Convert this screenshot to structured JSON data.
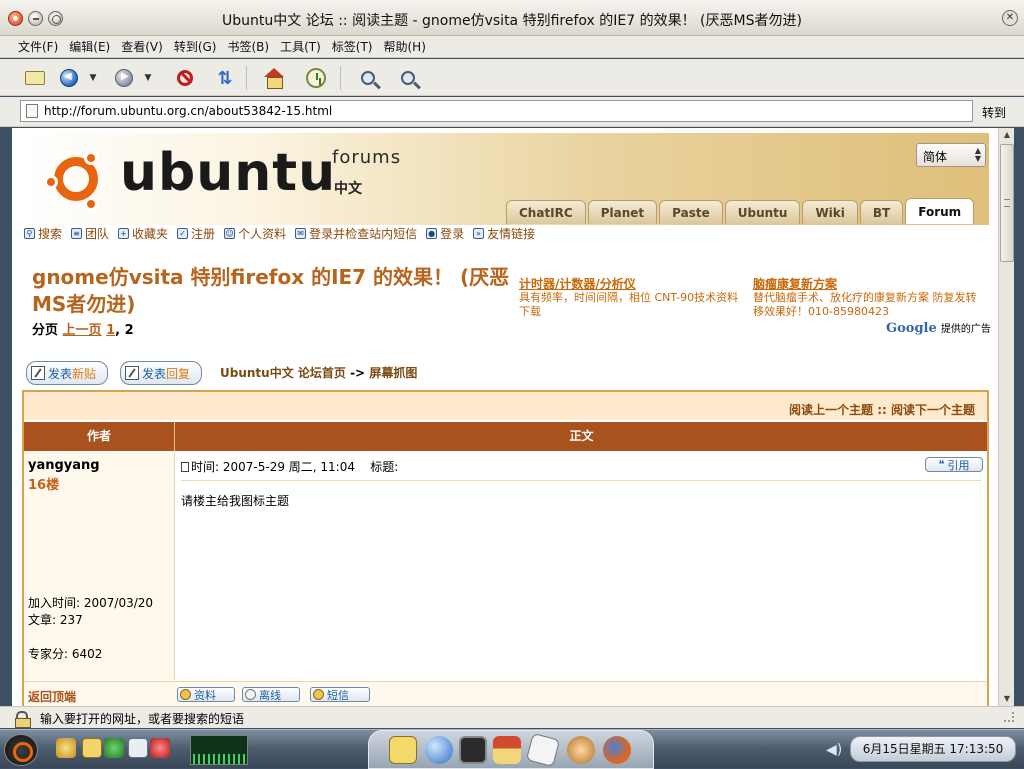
{
  "window": {
    "title": "Ubuntu中文 论坛 :: 阅读主题 - gnome仿vsita 特别firefox 的IE7 的效果！ (厌恶MS者勿进)"
  },
  "menubar": {
    "items": [
      "文件(F)",
      "编辑(E)",
      "查看(V)",
      "转到(G)",
      "书签(B)",
      "工具(T)",
      "标签(T)",
      "帮助(H)"
    ]
  },
  "toolbar": {
    "icons": [
      "new-window-icon",
      "back-icon",
      "forward-icon",
      "stop-icon",
      "reload-icon",
      "home-icon",
      "history-icon",
      "zoom-out-icon",
      "zoom-in-icon"
    ]
  },
  "urlbar": {
    "url": "http://forum.ubuntu.org.cn/about53842-15.html",
    "go_label": "转到"
  },
  "site": {
    "logo_text": "ubuntu",
    "logo_forums": "forums",
    "logo_chinese": "中文",
    "lang_select": "简体",
    "tabs": [
      "ChatIRC",
      "Planet",
      "Paste",
      "Ubuntu",
      "Wiki",
      "BT",
      "Forum"
    ],
    "active_tab": "Forum",
    "userbar": [
      "搜索",
      "团队",
      "收藏夹",
      "注册",
      "个人资料",
      "登录并检查站内短信",
      "登录",
      "友情链接"
    ]
  },
  "topic": {
    "title": "gnome仿vsita 特别firefox 的IE7 的效果！ (厌恶MS者勿进)",
    "pager_label": "分页",
    "pager_prev": "上一页",
    "pager_page1": "1",
    "pager_sep": ",",
    "pager_page2": "2"
  },
  "ads": {
    "left_title": "计时器/计数器/分析仪",
    "left_body": "具有频率，时间间隔，相位 CNT-90技术资料下载",
    "right_title": "脑瘤康复新方案",
    "right_body": "替代脑瘤手术、放化疗的康复新方案 防复发转移效果好！010-85980423",
    "google_brand": "Google",
    "google_suffix": "提供的广告"
  },
  "actions": {
    "new_topic_a": "发表",
    "new_topic_b": "新贴",
    "reply_a": "发表",
    "reply_b": "回复"
  },
  "breadcrumb": {
    "home": "Ubuntu中文 论坛首页",
    "sep": "->",
    "current": "屏幕抓图"
  },
  "thread_nav": {
    "prev": "阅读上一个主题",
    "sep": "::",
    "next": "阅读下一个主题"
  },
  "post_table": {
    "col_author": "作者",
    "col_body": "正文"
  },
  "post": {
    "author": "yangyang",
    "floor": "16楼",
    "joined": "加入时间: 2007/03/20",
    "posts": "文章: 237",
    "score": "专家分: 6402",
    "time": "时间: 2007-5-29 周二, 11:04",
    "subject_label": "标题:",
    "quote_label": "引用",
    "body": "请楼主给我图标主题",
    "back_to_top": "返回顶端",
    "profile_label": "资料",
    "offline_label": "离线",
    "pm_label": "短信"
  },
  "statusbar": {
    "text": "输入要打开的网址，或者要搜索的短语"
  },
  "panel": {
    "clock": "6月15日星期五 17:13:50"
  }
}
